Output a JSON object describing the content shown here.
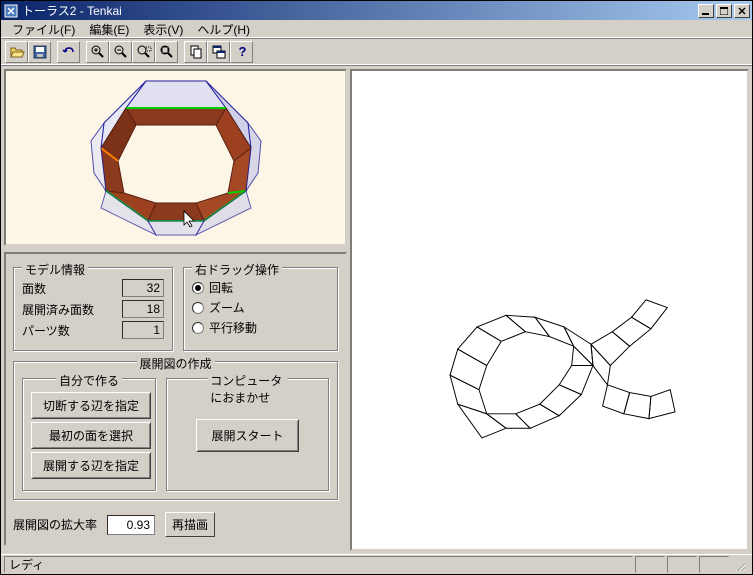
{
  "title": "トーラス2 - Tenkai",
  "menu": {
    "file": "ファイル(F)",
    "edit": "編集(E)",
    "view": "表示(V)",
    "help": "ヘルプ(H)"
  },
  "model_info": {
    "legend": "モデル情報",
    "faces_label": "面数",
    "faces_value": "32",
    "unfolded_label": "展開済み面数",
    "unfolded_value": "18",
    "parts_label": "パーツ数",
    "parts_value": "1"
  },
  "drag_ops": {
    "legend": "右ドラッグ操作",
    "rotate": "回転",
    "zoom": "ズーム",
    "pan": "平行移動",
    "selected": "rotate"
  },
  "unfold_create": {
    "legend": "展開図の作成",
    "self_legend": "自分で作る",
    "btn_cut_edge": "切断する辺を指定",
    "btn_first_face": "最初の面を選択",
    "btn_unfold_edge": "展開する辺を指定",
    "auto_legend": "コンピュータにおまかせ",
    "btn_start": "展開スタート"
  },
  "scale": {
    "label": "展開図の拡大率",
    "value": "0.93",
    "redraw": "再描画"
  },
  "status": "レディ"
}
